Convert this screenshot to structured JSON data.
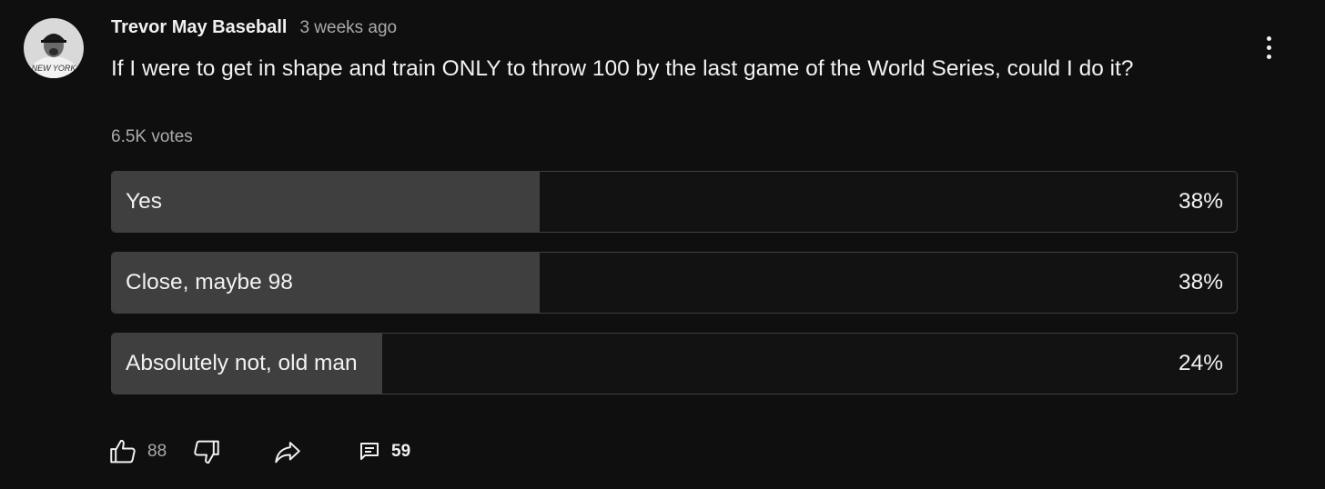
{
  "post": {
    "author": "Trevor May Baseball",
    "timestamp": "3 weeks ago",
    "question": "If I were to get in shape and train ONLY to throw 100 by the last game of the World Series, could I do it?",
    "votes": "6.5K votes"
  },
  "poll": {
    "options": [
      {
        "label": "Yes",
        "percent": "38%",
        "fraction": 0.38
      },
      {
        "label": "Close, maybe 98",
        "percent": "38%",
        "fraction": 0.38
      },
      {
        "label": "Absolutely not, old man",
        "percent": "24%",
        "fraction": 0.24
      }
    ]
  },
  "actions": {
    "like_icon": "thumbs-up-icon",
    "like_count": "88",
    "dislike_icon": "thumbs-down-icon",
    "share_icon": "share-icon",
    "comment_icon": "comment-icon",
    "comment_count": "59"
  },
  "colors": {
    "background": "#0f0f0f",
    "bar_fill": "#3f3f3f",
    "text_primary": "#f1f1f1",
    "text_secondary": "#aaaaaa"
  }
}
